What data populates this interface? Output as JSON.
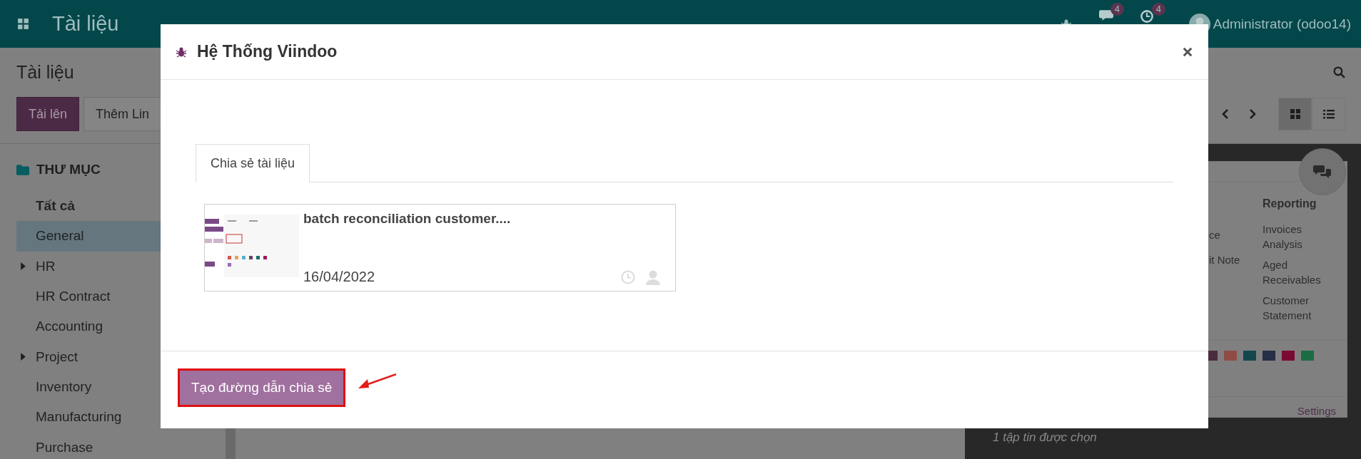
{
  "navbar": {
    "app_title": "Tài liệu",
    "messages_badge": "4",
    "activities_badge": "4",
    "user": "Administrator (odoo14)"
  },
  "control_panel": {
    "breadcrumb": "Tài liệu",
    "buttons": [
      {
        "label": "Tải lên",
        "kind": "primary"
      },
      {
        "label": "Thêm Lin",
        "kind": "secondary"
      }
    ],
    "views": [
      {
        "kind": "kanban",
        "selected": true
      },
      {
        "kind": "list",
        "selected": false
      }
    ]
  },
  "sidebar": {
    "heading": "THƯ MỤC",
    "items": [
      {
        "label": "Tất cả",
        "kind": "all",
        "selected": false,
        "has_children": false
      },
      {
        "label": "General",
        "kind": "folder",
        "selected": true,
        "has_children": false
      },
      {
        "label": "HR",
        "kind": "folder",
        "selected": false,
        "has_children": true
      },
      {
        "label": "HR Contract",
        "kind": "folder",
        "selected": false,
        "has_children": false
      },
      {
        "label": "Accounting",
        "kind": "folder",
        "selected": false,
        "has_children": false
      },
      {
        "label": "Project",
        "kind": "folder",
        "selected": false,
        "has_children": true
      },
      {
        "label": "Inventory",
        "kind": "folder",
        "selected": false,
        "has_children": false
      },
      {
        "label": "Manufacturing",
        "kind": "folder",
        "selected": false,
        "has_children": false
      },
      {
        "label": "Purchase",
        "kind": "folder",
        "selected": false,
        "has_children": false
      }
    ]
  },
  "preview_panel": {
    "column_1": [
      "ce",
      "it Note"
    ],
    "reporting": {
      "heading": "Reporting",
      "items": [
        "Invoices Analysis",
        "Aged Receivables",
        "Customer Statement"
      ]
    },
    "swatches": [
      {
        "color": "#4a2d3e"
      },
      {
        "color": "#8f4c47"
      },
      {
        "color": "#14474d"
      },
      {
        "color": "#262f45"
      },
      {
        "color": "#7a0a33"
      },
      {
        "color": "#1b6c44"
      }
    ],
    "settings_link": "Settings",
    "selection_info": "1 tập tin được chọn"
  },
  "dialog": {
    "title": "Hệ Thống Viindoo",
    "tabs": [
      {
        "label": "Chia sẻ tài liệu",
        "selected": true
      }
    ],
    "document": {
      "name": "batch reconciliation customer....",
      "date": "16/04/2022"
    },
    "primary_button": {
      "label": "Tạo đường dẫn chia sẻ",
      "highlighted": true
    },
    "annotation_arrow": true
  }
}
